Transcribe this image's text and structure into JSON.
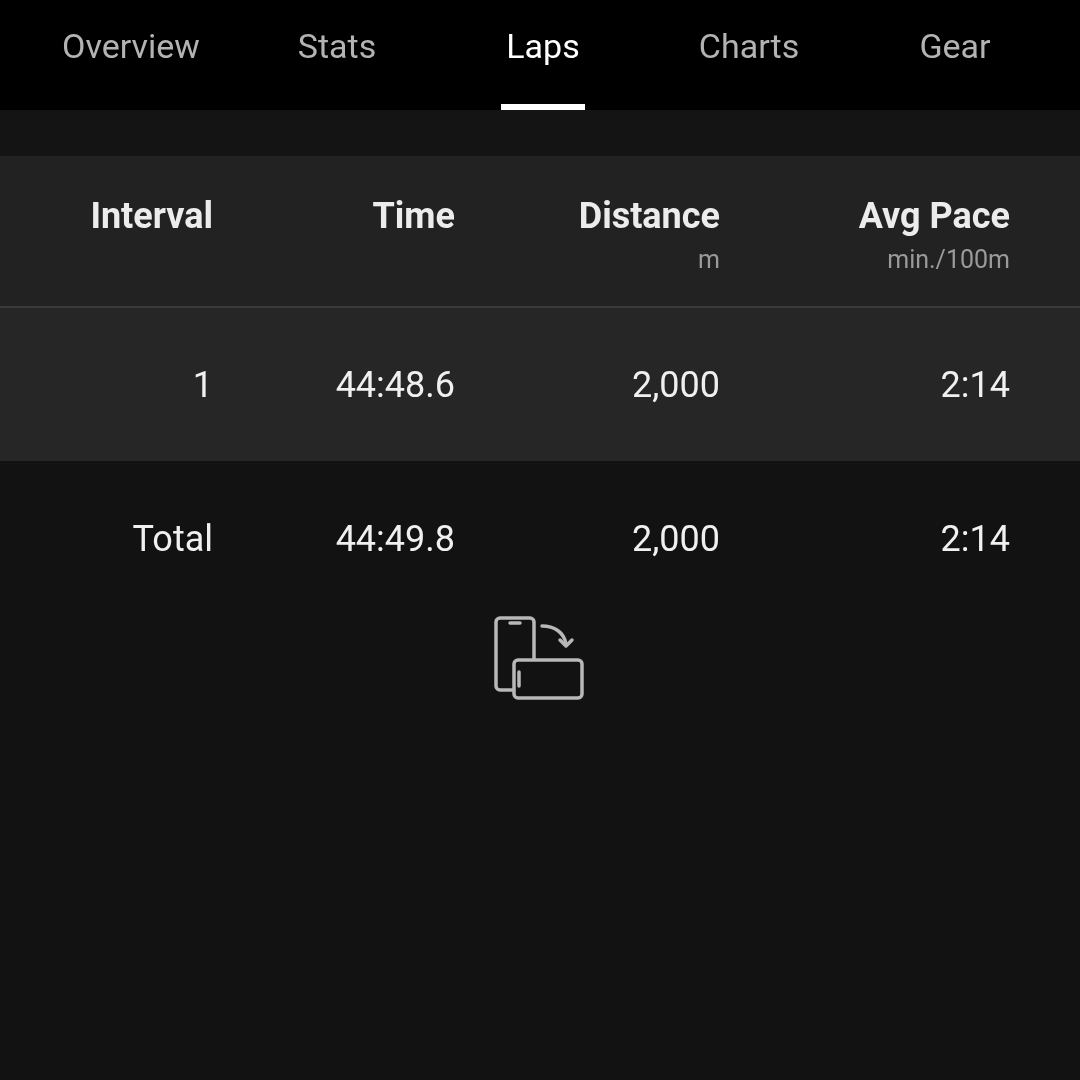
{
  "tabs": [
    {
      "label": "Overview",
      "selected": false
    },
    {
      "label": "Stats",
      "selected": false
    },
    {
      "label": "Laps",
      "selected": true
    },
    {
      "label": "Charts",
      "selected": false
    },
    {
      "label": "Gear",
      "selected": false
    }
  ],
  "table": {
    "columns": [
      {
        "label": "Interval"
      },
      {
        "label": "Time"
      },
      {
        "label": "Distance",
        "unit": "m"
      },
      {
        "label": "Avg Pace",
        "unit": "min./100m"
      }
    ],
    "rows": [
      [
        "1",
        "44:48.6",
        "2,000",
        "2:14"
      ]
    ],
    "total": [
      "Total",
      "44:49.8",
      "2,000",
      "2:14"
    ]
  }
}
